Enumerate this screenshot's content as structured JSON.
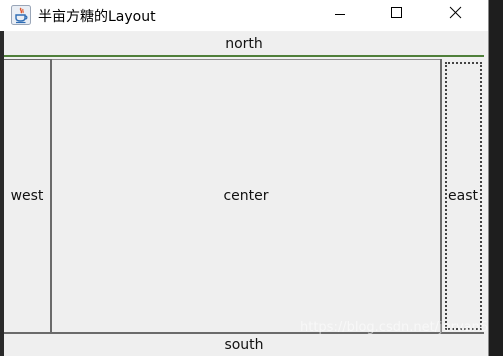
{
  "window": {
    "title": "半亩方糖的Layout",
    "controls": {
      "minimize": "minimize-icon",
      "maximize": "maximize-icon",
      "close": "close-icon"
    }
  },
  "layout": {
    "north": "north",
    "west": "west",
    "center": "center",
    "east": "east",
    "south": "south"
  },
  "watermark": "https://blog.csdn.net/jervan6",
  "colors": {
    "north_divider": "#4f7f3a",
    "panel_background": "#efefef",
    "titlebar_background": "#ffffff",
    "desktop_background": "#1e1e1e"
  }
}
